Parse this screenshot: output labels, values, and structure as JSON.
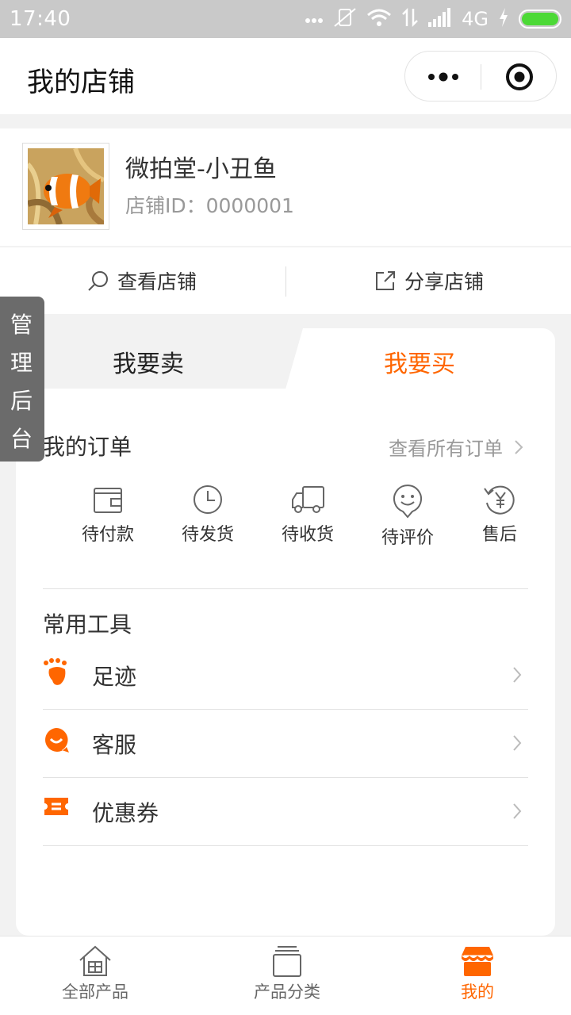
{
  "status_bar": {
    "time": "17:40",
    "network": "4G",
    "colors": {
      "battery": "#4cd936"
    }
  },
  "navbar": {
    "title": "我的店铺"
  },
  "shop": {
    "name": "微拍堂-小丑鱼",
    "id_label": "店铺ID：0000001"
  },
  "shop_actions": {
    "view": "查看店铺",
    "share": "分享店铺"
  },
  "tabs": [
    {
      "label": "我要卖",
      "active": false
    },
    {
      "label": "我要买",
      "active": true
    }
  ],
  "orders": {
    "title": "我的订单",
    "see_all": "查看所有订单",
    "items": [
      {
        "label": "待付款",
        "icon": "wallet-icon"
      },
      {
        "label": "待发货",
        "icon": "clock-icon"
      },
      {
        "label": "待收货",
        "icon": "truck-icon"
      },
      {
        "label": "待评价",
        "icon": "smile-icon"
      },
      {
        "label": "售后",
        "icon": "refund-icon"
      }
    ]
  },
  "tools": {
    "title": "常用工具",
    "items": [
      {
        "label": "足迹",
        "icon": "footprint-icon"
      },
      {
        "label": "客服",
        "icon": "customer-service-icon"
      },
      {
        "label": "优惠券",
        "icon": "coupon-icon"
      }
    ]
  },
  "admin_tab": {
    "chars": [
      "管",
      "理",
      "后",
      "台"
    ]
  },
  "tabbar": {
    "items": [
      {
        "label": "全部产品",
        "icon": "home-products-icon",
        "active": false
      },
      {
        "label": "产品分类",
        "icon": "category-icon",
        "active": false
      },
      {
        "label": "我的",
        "icon": "shop-icon",
        "active": true
      }
    ]
  },
  "colors": {
    "accent": "#ff6600",
    "background": "#f2f2f2"
  }
}
